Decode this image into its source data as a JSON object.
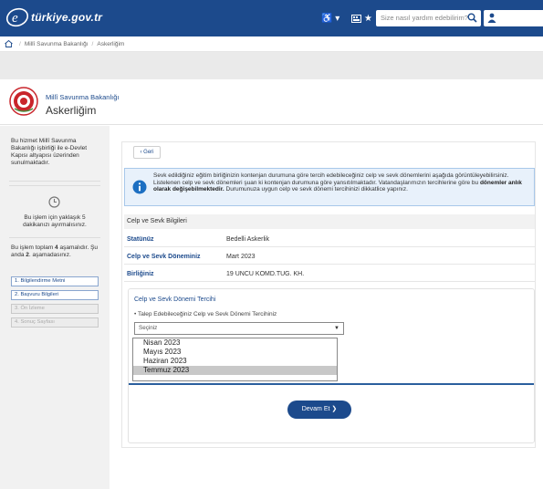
{
  "header": {
    "logo_text": "türkiye.gov.tr",
    "access_label": "♿ ▾",
    "search_placeholder": "Size nasıl yardım edebilirim?",
    "colors": {
      "brand": "#1c4a8c"
    }
  },
  "breadcrumb": [
    "Millî Savunma Bakanlığı",
    "Askerliğim"
  ],
  "institution": {
    "name": "Millî Savunma Bakanlığı",
    "title": "Askerliğim"
  },
  "sidebar": {
    "description": "Bu hizmet  Millî Savunma Bakanlığı işbirliği ile e-Devlet Kapısı altyapısı üzerinden sunulmaktadır.",
    "time_note": "Bu işlem için yaklaşık 5 dakikanızı ayırmalısınız.",
    "steps_text_1": "Bu işlem toplam ",
    "steps_total": "4",
    "steps_text_2": " aşamalıdır. Şu anda ",
    "steps_current": "2",
    "steps_text_3": ". aşamadasınız.",
    "steps": [
      {
        "label": "1. Bilgilendirme Metni",
        "state": "done"
      },
      {
        "label": "2. Başvuru Bilgileri",
        "state": "done"
      },
      {
        "label": "3. Ön İzleme",
        "state": "todo"
      },
      {
        "label": "4. Sonuç Sayfası",
        "state": "todo"
      }
    ]
  },
  "main": {
    "back_label": "Geri",
    "info_part1": "Sevk edildiğiniz eğitim birliğinizin kontenjan durumuna göre tercih edebileceğiniz celp ve sevk dönemlerini aşağıda görüntüleyebilirsiniz. Listelenen celp ve sevk dönemleri şuan ki kontenjan durumuna göre yansıtılmaktadır. Vatandaşlarımızın tercihlerine göre bu ",
    "info_bold": "dönemler anlık olarak değişebilmektedir.",
    "info_part2": " Durumunuza uygun celp ve sevk dönemi tercihinizi dikkatlice yapınız.",
    "section_title": "Celp ve Sevk Bilgileri",
    "rows": [
      {
        "key": "Statünüz",
        "value": "Bedelli Askerlik"
      },
      {
        "key": "Celp ve Sevk Döneminiz",
        "value": "Mart 2023"
      },
      {
        "key": "Birliğiniz",
        "value": "19 UNCU KOMD.TUG. KH."
      }
    ],
    "form": {
      "title": "Celp ve Sevk  Dönemi Tercihi",
      "field_label": "• Talep Edebileceğiniz Celp ve Sevk Dönemi Tercihiniz",
      "select_value": "Seçiniz",
      "options": [
        "Nisan 2023",
        "Mayıs 2023",
        "Haziran 2023",
        "Temmuz 2023"
      ],
      "highlighted_option": "Temmuz 2023",
      "submit_label": "Devam Et ❯"
    }
  }
}
